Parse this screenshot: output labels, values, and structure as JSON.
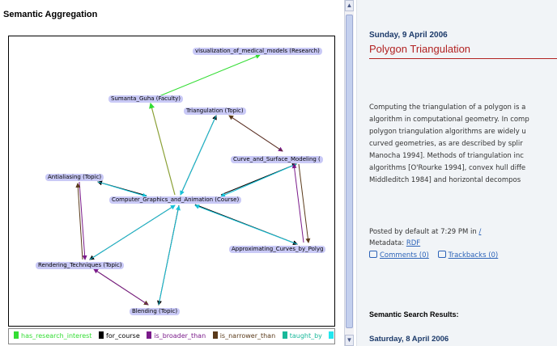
{
  "left": {
    "title": "Semantic Aggregation",
    "nodes": [
      {
        "id": "vis",
        "label": "visualization_of_medical_models (Research)"
      },
      {
        "id": "guha",
        "label": "Sumanta_Guha (Faculty)"
      },
      {
        "id": "tri",
        "label": "Triangulation (Topic)"
      },
      {
        "id": "csm",
        "label": "Curve_and_Surface_Modeling ("
      },
      {
        "id": "anti",
        "label": "Antialiasing (Topic)"
      },
      {
        "id": "cga",
        "label": "Computer_Graphics_and_Animation (Course)"
      },
      {
        "id": "acp",
        "label": "Approximating_Curves_by_Polyg"
      },
      {
        "id": "rt",
        "label": "Rendering_Techniques (Topic)"
      },
      {
        "id": "blend",
        "label": "Blending (Topic)"
      }
    ],
    "legend": [
      {
        "label": "has_research_interest",
        "color": "#33dd33"
      },
      {
        "label": "for_course",
        "color": "#000000"
      },
      {
        "label": "is_broader_than",
        "color": "#7a1a8a"
      },
      {
        "label": "is_narrower_than",
        "color": "#5a3a1a"
      },
      {
        "label": "taught_by",
        "color": "#18b89a"
      },
      {
        "label": "",
        "color": "#22e6ee"
      }
    ]
  },
  "right": {
    "date": "Sunday, 9 April 2006",
    "title": "Polygon Triangulation",
    "body_lines": [
      "Computing the triangulation of a polygon is a",
      "algorithm in computational geometry. In comp",
      "polygon triangulation algorithms are widely u",
      "curved geometries, as are described by splir",
      "Manocha 1994]. Methods of triangulation inc",
      "algorithms [O'Rourke 1994], convex hull diffe",
      "Middleditch 1984] and horizontal decompos"
    ],
    "posted_prefix": "Posted by default at 7:29 PM in",
    "posted_link": "/",
    "metadata_label": "Metadata:",
    "metadata_link": "RDF",
    "comments": "Comments (0)",
    "trackbacks": "Trackbacks (0)",
    "semantic_heading": "Semantic Search Results:",
    "next_date": "Saturday, 8 April 2006"
  },
  "colors": {
    "has_research_interest": "#33dd33",
    "for_course": "#000000",
    "is_broader_than": "#7a1a8a",
    "is_narrower_than": "#5a3a1a",
    "taught_by": "#18b89a",
    "cyan": "#22e6ee",
    "node_fill": "#c9c9f6",
    "title_red": "#b22222"
  }
}
